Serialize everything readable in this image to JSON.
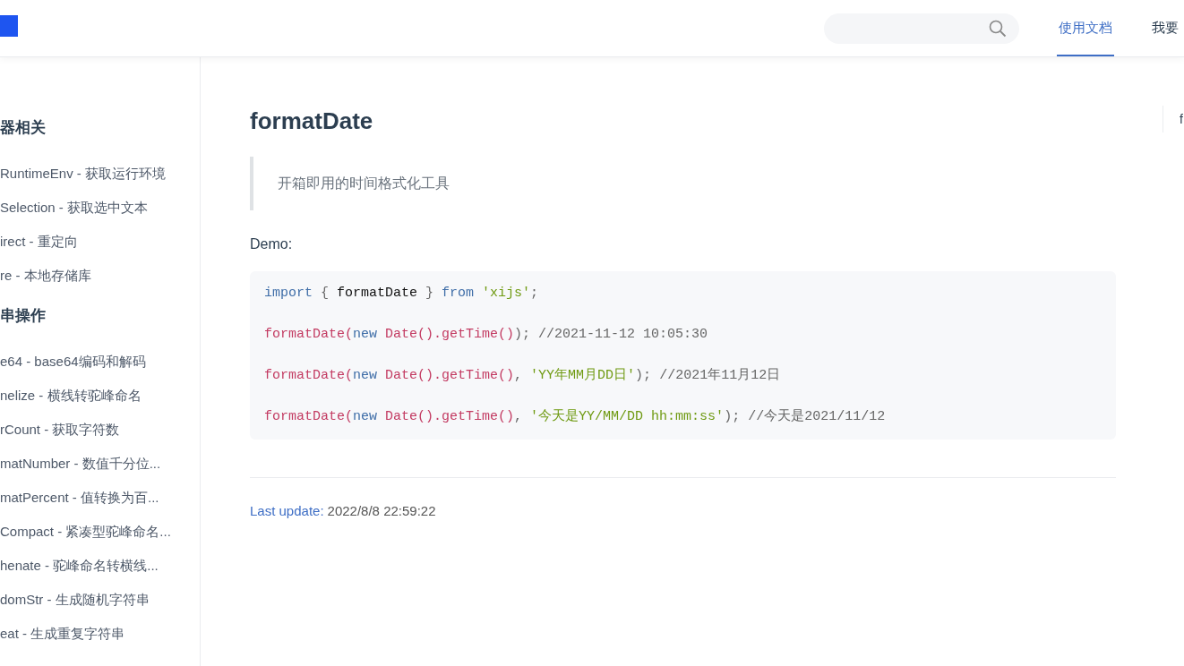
{
  "header": {
    "nav": [
      {
        "label": "使用文档",
        "selected": true
      },
      {
        "label": "我要",
        "selected": false
      }
    ]
  },
  "sidebar": {
    "groups": [
      {
        "title": "器相关",
        "items": [
          "RuntimeEnv - 获取运行环境",
          "Selection - 获取选中文本",
          "irect - 重定向",
          "re - 本地存储库"
        ]
      },
      {
        "title": "串操作",
        "items": [
          "e64 - base64编码和解码",
          "nelize - 横线转驼峰命名",
          "rCount - 获取字符数",
          "matNumber - 数值千分位...",
          "matPercent - 值转换为百...",
          "Compact - 紧凑型驼峰命名...",
          "henate - 驼峰命名转横线...",
          "domStr - 生成随机字符串",
          "eat - 生成重复字符串"
        ]
      }
    ]
  },
  "content": {
    "title": "formatDate",
    "quote": "开箱即用的时间格式化工具",
    "demo_label": "Demo:",
    "code": [
      [
        {
          "kind": "keyword",
          "text": "import"
        },
        {
          "kind": "punct",
          "text": " { "
        },
        {
          "kind": "plain",
          "text": "formatDate"
        },
        {
          "kind": "punct",
          "text": " } "
        },
        {
          "kind": "keyword",
          "text": "from "
        },
        {
          "kind": "string",
          "text": "'xijs'"
        },
        {
          "kind": "punct",
          "text": ";"
        }
      ],
      [
        {
          "kind": "func",
          "text": "formatDate("
        },
        {
          "kind": "keyword",
          "text": "new "
        },
        {
          "kind": "func",
          "text": "Date().getTime()"
        },
        {
          "kind": "punct",
          "text": "); "
        },
        {
          "kind": "comment",
          "text": "//2021-11-12 10:05:30"
        }
      ],
      [
        {
          "kind": "func",
          "text": "formatDate("
        },
        {
          "kind": "keyword",
          "text": "new "
        },
        {
          "kind": "func",
          "text": "Date().getTime()"
        },
        {
          "kind": "punct",
          "text": ", "
        },
        {
          "kind": "string",
          "text": "'YY年MM月DD日'"
        },
        {
          "kind": "punct",
          "text": "); "
        },
        {
          "kind": "comment",
          "text": "//2021年11月12日"
        }
      ],
      [
        {
          "kind": "func",
          "text": "formatDate("
        },
        {
          "kind": "keyword",
          "text": "new "
        },
        {
          "kind": "func",
          "text": "Date().getTime()"
        },
        {
          "kind": "punct",
          "text": ", "
        },
        {
          "kind": "string",
          "text": "'今天是YY/MM/DD hh:mm:ss'"
        },
        {
          "kind": "punct",
          "text": "); "
        },
        {
          "kind": "comment",
          "text": "//今天是2021/11/12"
        }
      ]
    ],
    "last_update_label": "Last update:",
    "last_update_value": "2022/8/8 22:59:22"
  },
  "toc": {
    "items": [
      "f"
    ]
  }
}
